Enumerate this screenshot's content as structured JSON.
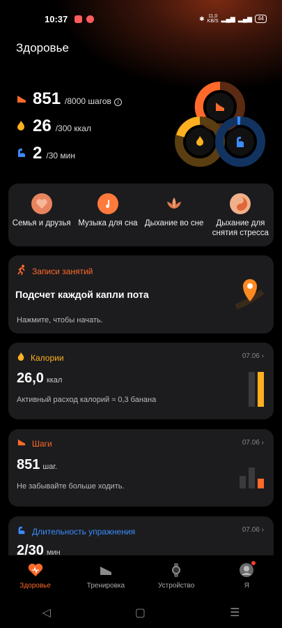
{
  "status": {
    "time": "10:37",
    "net_speed_top": "11,0",
    "net_speed_unit": "KB/S",
    "battery": "44"
  },
  "page": {
    "title": "Здоровье"
  },
  "summary": {
    "steps": {
      "value": "851",
      "goal": "/8000 шагов",
      "icon": "shoe-icon",
      "color": "#ff6a2a"
    },
    "calories": {
      "value": "26",
      "goal": "/300 ккал",
      "icon": "flame-icon",
      "color": "#ffb020"
    },
    "exercise": {
      "value": "2",
      "goal": "/30 мин",
      "icon": "bicep-icon",
      "color": "#3a8cff"
    }
  },
  "quick_actions": [
    {
      "label": "Семья и друзья",
      "icon": "heart-hands-icon"
    },
    {
      "label": "Музыка для сна",
      "icon": "music-moon-icon"
    },
    {
      "label": "Дыхание во сне",
      "icon": "lotus-icon"
    },
    {
      "label": "Дыхание для снятия стресса",
      "icon": "yin-yang-icon"
    }
  ],
  "activity_card": {
    "header": "Записи занятий",
    "title": "Подсчет каждой капли пота",
    "subtitle": "Нажмите, чтобы начать."
  },
  "calories_card": {
    "header": "Калории",
    "date": "07.06",
    "value": "26,0",
    "unit": "ккал",
    "subtitle": "Активный расход калорий ≈ 0,3 банана"
  },
  "steps_card": {
    "header": "Шаги",
    "date": "07.06",
    "value": "851",
    "unit": "шаг.",
    "subtitle": "Не забывайте больше ходить."
  },
  "exercise_card": {
    "header": "Длительность упражнения",
    "date": "07.06",
    "value": "2/30",
    "unit": "мин"
  },
  "bottom_nav": [
    {
      "label": "Здоровье",
      "icon": "heart-icon",
      "active": true
    },
    {
      "label": "Тренировка",
      "icon": "running-shoe-icon",
      "active": false
    },
    {
      "label": "Устройство",
      "icon": "watch-icon",
      "active": false
    },
    {
      "label": "Я",
      "icon": "profile-icon",
      "active": false
    }
  ],
  "colors": {
    "accent": "#ff6a2a",
    "orange": "#ffb020",
    "blue": "#3a8cff",
    "card": "#1c1c1e"
  }
}
